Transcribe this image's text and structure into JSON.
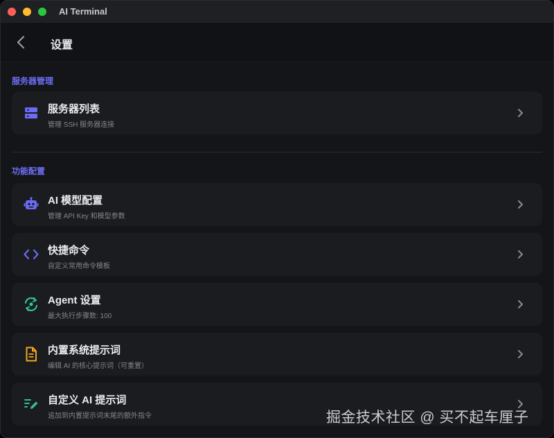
{
  "window": {
    "title": "AI Terminal"
  },
  "header": {
    "title": "设置"
  },
  "sections": [
    {
      "title": "服务器管理",
      "items": [
        {
          "label": "服务器列表",
          "sublabel": "管理 SSH 服务器连接",
          "icon": "server-icon",
          "color": "#6a6cf6"
        }
      ]
    },
    {
      "title": "功能配置",
      "items": [
        {
          "label": "AI 模型配置",
          "sublabel": "管理 API Key 和模型参数",
          "icon": "robot-icon",
          "color": "#6a6cf6"
        },
        {
          "label": "快捷命令",
          "sublabel": "自定义常用命令模板",
          "icon": "code-icon",
          "color": "#6a6cf6"
        },
        {
          "label": "Agent 设置",
          "sublabel": "最大执行步骤数: 100",
          "icon": "agent-sync-icon",
          "color": "#2fc48a"
        },
        {
          "label": "内置系统提示词",
          "sublabel": "编辑 AI 的核心提示词（可重置）",
          "icon": "document-icon",
          "color": "#f2a623"
        },
        {
          "label": "自定义 AI 提示词",
          "sublabel": "追加到内置提示词末尾的额外指令",
          "icon": "edit-list-icon",
          "color": "#2fc48a"
        }
      ]
    }
  ],
  "watermark": "掘金技术社区 @ 买不起车厘子"
}
